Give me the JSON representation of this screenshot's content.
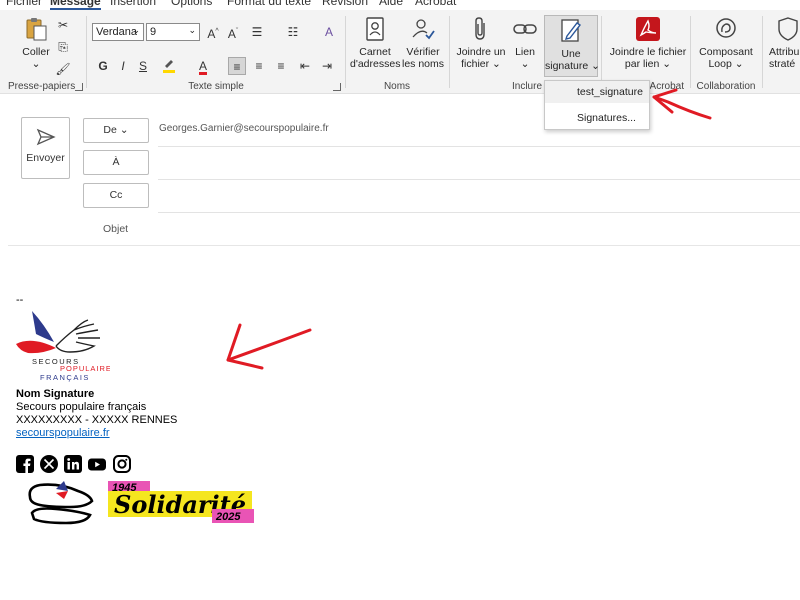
{
  "menu": {
    "tabs": [
      "Fichier",
      "Message",
      "Insertion",
      "Options",
      "Format du texte",
      "Révision",
      "Aide",
      "Acrobat"
    ],
    "active": "Message"
  },
  "ribbon": {
    "clipboard": {
      "paste_label": "Coller",
      "group_label": "Presse-papiers"
    },
    "basic_text": {
      "font_name": "Verdana",
      "font_size": "9",
      "bold": "G",
      "italic": "I",
      "underline": "S",
      "group_label": "Texte simple"
    },
    "names": {
      "address_book": [
        "Carnet",
        "d'adresses"
      ],
      "check_names": [
        "Vérifier",
        "les noms"
      ],
      "group_label": "Noms"
    },
    "include": {
      "attach_file": [
        "Joindre un",
        "fichier"
      ],
      "link": "Lien",
      "signature": [
        "Une",
        "signature"
      ],
      "group_label": "Inclure"
    },
    "acrobat": {
      "attach_link": [
        "Joindre le fichier",
        "par lien"
      ],
      "group_label": "Acrobat"
    },
    "collaboration": {
      "loop": [
        "Composant",
        "Loop"
      ],
      "group_label": "Collaboration"
    },
    "sensitivity": {
      "label": [
        "Attribu",
        "straté"
      ]
    }
  },
  "signature_menu": {
    "items": [
      "test_signature",
      "Signatures..."
    ]
  },
  "compose": {
    "send_label": "Envoyer",
    "from_label": "De",
    "from_value": "Georges.Garnier@secourspopulaire.fr",
    "to_label": "À",
    "cc_label": "Cc",
    "subject_label": "Objet"
  },
  "signature": {
    "separator": "--",
    "logo_text": [
      "SECOURS",
      "POPULAIRE",
      "FRANÇAIS"
    ],
    "name": "Nom Signature",
    "org": "Secours populaire français",
    "address": "XXXXXXXXX - XXXXX RENNES",
    "website": "secourspopulaire.fr",
    "social_icons": [
      "facebook-icon",
      "x-icon",
      "linkedin-icon",
      "youtube-icon",
      "instagram-icon"
    ],
    "banner": {
      "year_start": "1945",
      "word": "Solidarité",
      "year_end": "2025"
    }
  },
  "colors": {
    "accent": "#2b579a",
    "annotation": "#e01b24",
    "pdf_red": "#c4161c",
    "link": "#0563c1",
    "banner_yellow": "#f5e61f",
    "banner_pink": "#e954b5",
    "logo_blue": "#2d3a8c"
  }
}
